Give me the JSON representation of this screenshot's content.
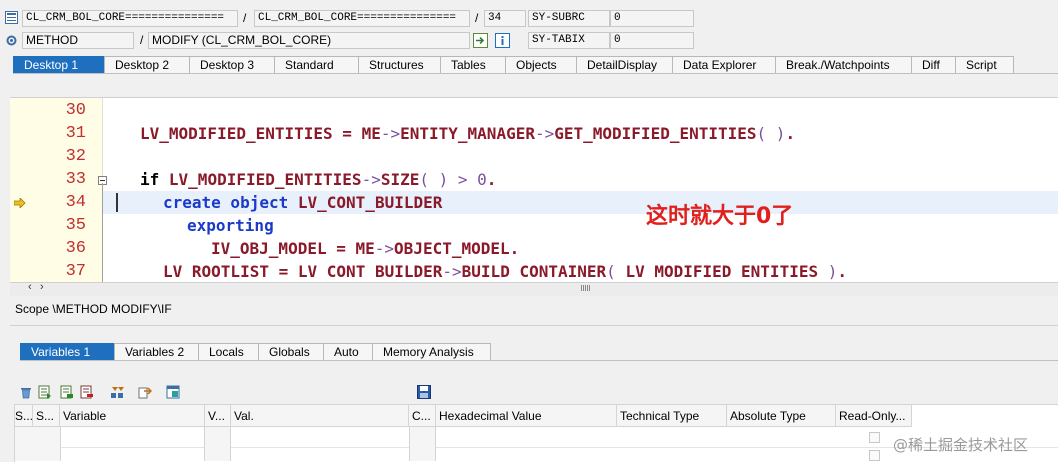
{
  "header": {
    "row1": {
      "program": "CL_CRM_BOL_CORE===============",
      "include": "CL_CRM_BOL_CORE===============",
      "line": "34",
      "sysvar": "SY-SUBRC",
      "sysval": "0"
    },
    "row2": {
      "kind": "METHOD",
      "event": "MODIFY (CL_CRM_BOL_CORE)",
      "sysvar": "SY-TABIX",
      "sysval": "0"
    },
    "slash": "/"
  },
  "tabs": [
    "Desktop 1",
    "Desktop 2",
    "Desktop 3",
    "Standard",
    "Structures",
    "Tables",
    "Objects",
    "DetailDisplay",
    "Data Explorer",
    "Break./Watchpoints",
    "Diff",
    "Script"
  ],
  "code": {
    "line_numbers": [
      "30",
      "31",
      "32",
      "33",
      "34",
      "35",
      "36",
      "37"
    ],
    "annotation": "这时就大于0了",
    "annotation_color": "#e0201c"
  },
  "scope": "Scope \\METHOD MODIFY\\IF",
  "var_tabs": [
    "Variables 1",
    "Variables 2",
    "Locals",
    "Globals",
    "Auto",
    "Memory Analysis"
  ],
  "grid": {
    "columns": [
      "S...",
      "Variable",
      "V...",
      "Val.",
      "C...",
      "Hexadecimal Value",
      "Technical Type",
      "Absolute Type",
      "Read-Only..."
    ]
  },
  "watermark": "@稀土掘金技术社区",
  "colors": {
    "accent": "#1f6fbf",
    "keyword": "#1a3ac8",
    "identifier": "#8a1a2a",
    "line_number": "#c03030"
  }
}
